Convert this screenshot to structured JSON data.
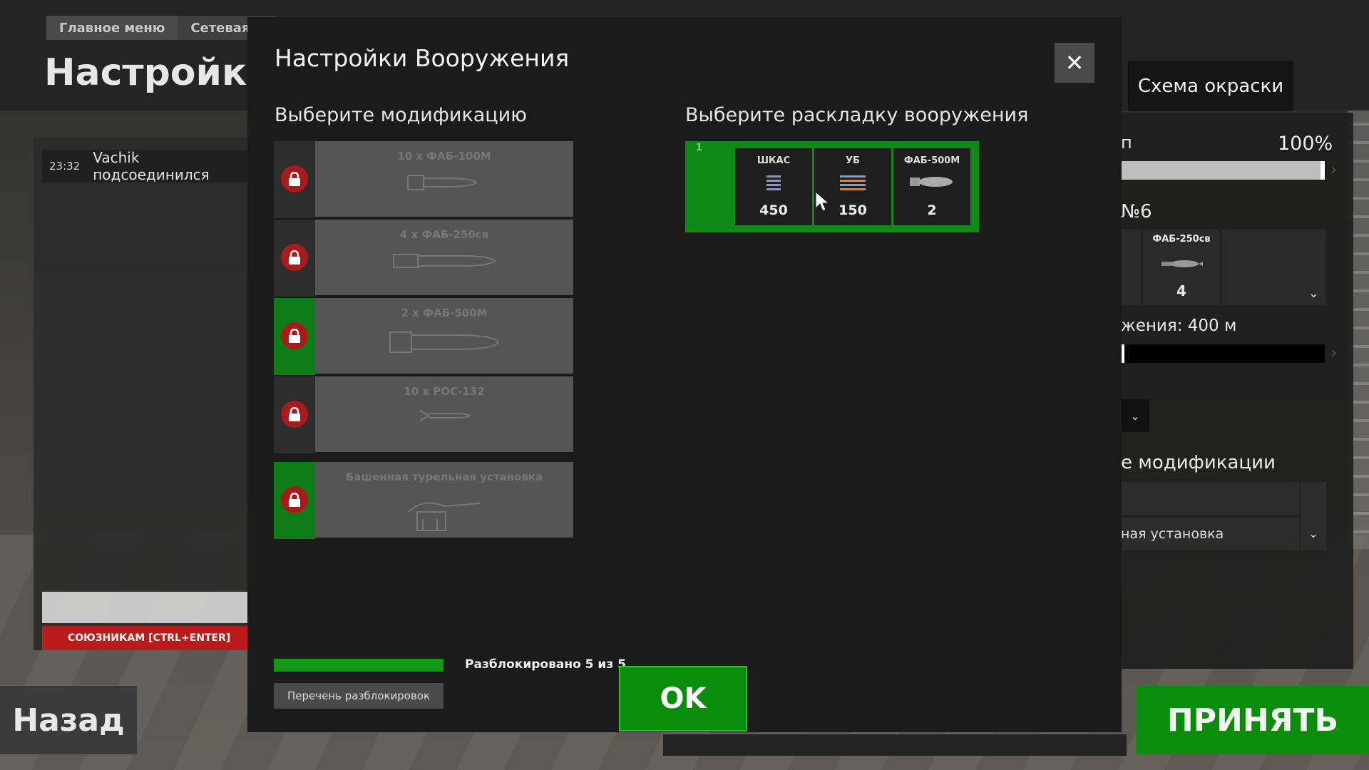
{
  "background": {
    "breadcrumb": [
      "Главное меню",
      "Сетевая и"
    ],
    "page_title": "Настройка с",
    "chat": {
      "time": "23:32",
      "message": "Vachik подсоединился",
      "mode": "СОЮЗНИКАМ [CTRL+ENTER]"
    },
    "back_label": "Назад",
    "accept_label": "ПРИНЯТЬ",
    "right_panel": {
      "tab_label": "Схема окраски",
      "label1": "п",
      "percent": "100%",
      "label2": "№6",
      "cell_title": "ФАБ-250св",
      "cell_count": "4",
      "distance_label": "жения: 400 м",
      "mods_label": "е модификации",
      "mods_value": "ная установка"
    }
  },
  "modal": {
    "title": "Настройки Вооружения",
    "close_icon": "close-icon",
    "modifications_title": "Выберите модификацию",
    "loadout_title": "Выберите раскладку вооружения",
    "modifications": [
      {
        "name": "10 x ФАБ-100М",
        "icon": "bomb-icon",
        "highlight": false
      },
      {
        "name": "4 x ФАБ-250св",
        "icon": "bomb-icon",
        "highlight": false
      },
      {
        "name": "2 x ФАБ-500М",
        "icon": "bomb-icon",
        "highlight": true
      },
      {
        "name": "10 x РОС-132",
        "icon": "rocket-icon",
        "highlight": false
      },
      {
        "name": "Башенная турельная установка",
        "icon": "turret-icon",
        "highlight": true
      }
    ],
    "loadout": {
      "index": "1",
      "slots": [
        {
          "title": "ШКАС",
          "count": "450",
          "icon": "ammo-belt-icon"
        },
        {
          "title": "УБ",
          "count": "150",
          "icon": "ammo-belt-icon"
        },
        {
          "title": "ФАБ-500М",
          "count": "2",
          "icon": "bomb-icon"
        }
      ]
    },
    "unlocked_text": "Разблокировано 5 из 5",
    "unlocked_fraction": 1.0,
    "unlock_list_label": "Перечень разблокировок",
    "ok_label": "OK"
  },
  "colors": {
    "accent_green": "#0a8d0a",
    "lock_red": "#aa1a1a",
    "chat_mode_red": "#c11818"
  }
}
